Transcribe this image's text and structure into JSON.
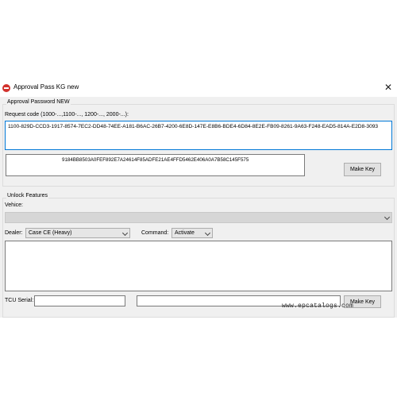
{
  "window": {
    "title": "Approval Pass KG new",
    "close_glyph": "✕",
    "app_icon": "app-logo-icon"
  },
  "approval": {
    "group_label": "Approval Password NEW",
    "request_label": "Request code (1000-...,1100-..., 1200-..., 2000-...):",
    "request_code": "1100-829D-CCD3-1917-8574-7EC2-DD48-74EE-A181-B6AC-26B7-4200-6E8D-147E-E8B6-BDE4-6D84-8E2E-FB09-8261-9A63-F248-EAD5-814A-E2D8-3093",
    "password": "9184BB8503A0FEF892E7A24614F85ADFE21AE4FFD5462E406A0A7B58C145F575",
    "make_key_label": "Make Key"
  },
  "unlock": {
    "group_label": "Unlock Features",
    "vehicle_label": "Vehice:",
    "vehicle_value": "",
    "dealer_label": "Dealer:",
    "dealer_value": "Case CE (Heavy)",
    "command_label": "Command:",
    "command_value": "Activate",
    "output_text": "",
    "tcu_label": "TCU Serial:",
    "tcu_value": "",
    "key_value": "",
    "make_key_label": "Make Key"
  },
  "watermark": "www.epcatalogs.com"
}
